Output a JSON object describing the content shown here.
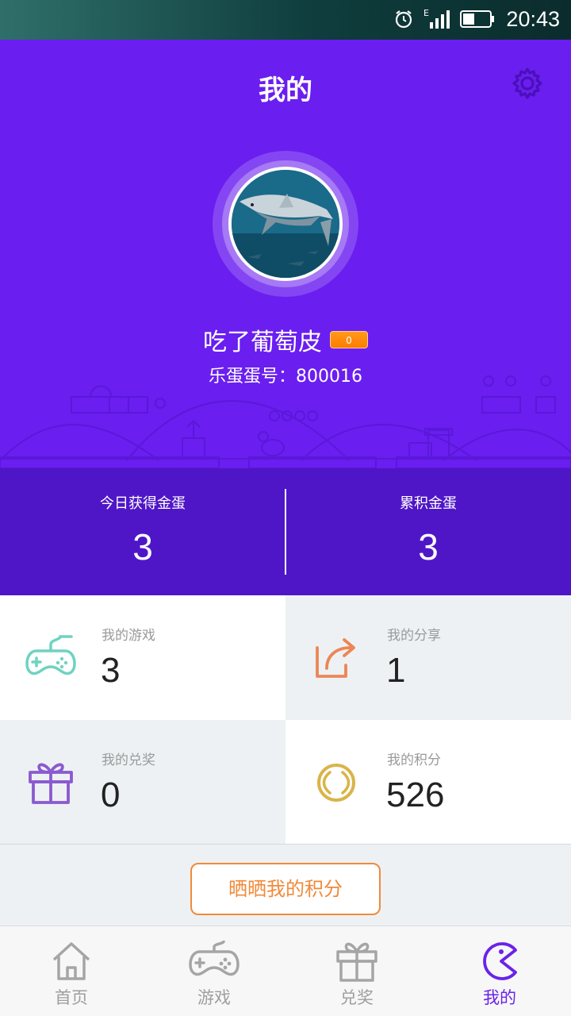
{
  "status_bar": {
    "time": "20:43",
    "network": "E"
  },
  "header": {
    "title": "我的",
    "settings_icon": "gear-icon"
  },
  "profile": {
    "username": "吃了葡萄皮",
    "level": "0",
    "egg_id_label": "乐蛋蛋号：800016"
  },
  "egg_stats": {
    "today": {
      "label": "今日获得金蛋",
      "value": "3"
    },
    "total": {
      "label": "累积金蛋",
      "value": "3"
    }
  },
  "tiles": {
    "games": {
      "label": "我的游戏",
      "value": "3",
      "icon": "gamepad-icon"
    },
    "shares": {
      "label": "我的分享",
      "value": "1",
      "icon": "share-icon"
    },
    "redeem": {
      "label": "我的兑奖",
      "value": "0",
      "icon": "gift-icon"
    },
    "points": {
      "label": "我的积分",
      "value": "526",
      "icon": "coin-icon"
    }
  },
  "share_points_button": "晒晒我的积分",
  "bottom_nav": [
    {
      "label": "首页",
      "icon": "home-icon"
    },
    {
      "label": "游戏",
      "icon": "gamepad-icon"
    },
    {
      "label": "兑奖",
      "icon": "gift-icon"
    },
    {
      "label": "我的",
      "icon": "pacman-icon",
      "active": true
    }
  ],
  "colors": {
    "primary": "#6a1ef0",
    "stats_bg": "#4f16c8",
    "accent_orange": "#f08a3a",
    "teal": "#6fd3c0",
    "purple_icon": "#8a5ad0",
    "gold": "#d9b44a"
  }
}
